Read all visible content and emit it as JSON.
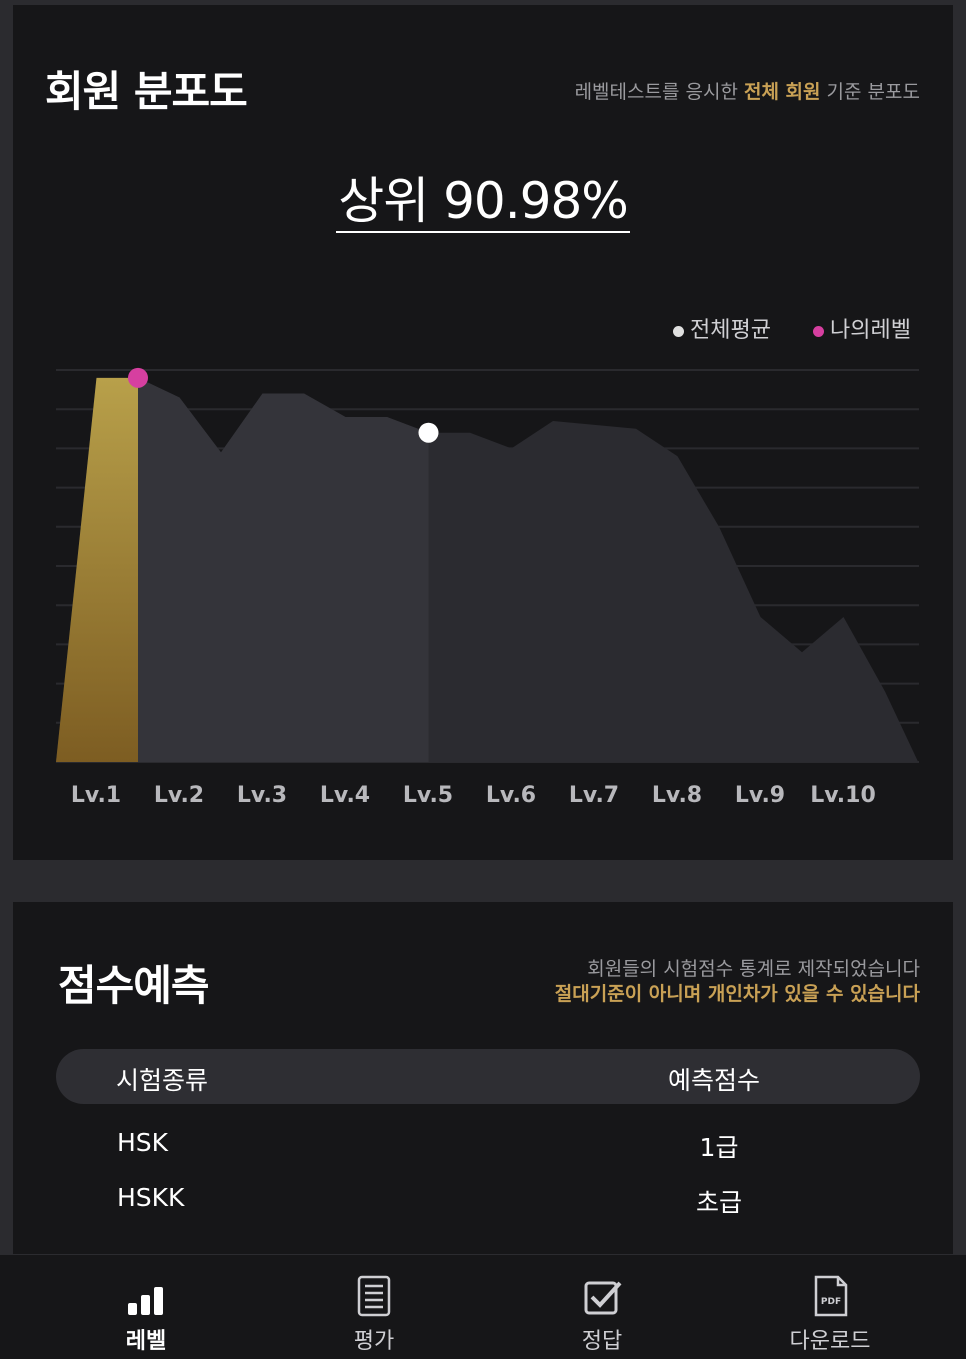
{
  "distribution": {
    "title": "회원 분포도",
    "desc_pre": "레벨테스트를 응시한 ",
    "desc_highlight": "전체 회원",
    "desc_post": " 기준 분포도",
    "rank_text": "상위 90.98%",
    "legend": [
      {
        "label": "전체평균",
        "color": "#e0e0e0"
      },
      {
        "label": "나의레벨",
        "color": "#d63fa0"
      }
    ]
  },
  "chart_data": {
    "type": "area",
    "categories": [
      "Lv.1",
      "Lv.2",
      "Lv.3",
      "Lv.4",
      "Lv.5",
      "Lv.6",
      "Lv.7",
      "Lv.8",
      "Lv.9",
      "Lv.10"
    ],
    "x": [
      0.0,
      0.5,
      1.0,
      1.5,
      2.0,
      2.5,
      3.0,
      3.5,
      4.0,
      4.5,
      5.0,
      5.5,
      6.0,
      6.5,
      7.0,
      7.5,
      8.0,
      8.5,
      9.0,
      9.5,
      10.0,
      10.4
    ],
    "values": [
      0,
      98,
      98,
      93,
      79,
      94,
      94,
      88,
      88,
      84,
      84,
      80,
      87,
      86,
      85,
      78,
      60,
      37,
      28,
      37,
      18,
      0
    ],
    "my_level_x": 1.0,
    "average_x": 4.5,
    "grid": true,
    "ylim": [
      0,
      100
    ],
    "colors": {
      "base": "#2b2b30",
      "highlight": "#34343a",
      "mine": "#b39a48",
      "mine_dot": "#d63fa0",
      "avg_dot": "#ffffff"
    }
  },
  "prediction": {
    "title": "점수예측",
    "desc_line1": "회원들의 시험점수 통계로 제작되었습니다",
    "desc_line2": "절대기준이 아니며 개인차가 있을 수 있습니다",
    "headers": {
      "type": "시험종류",
      "score": "예측점수"
    },
    "rows": [
      {
        "type": "HSK",
        "score": "1급"
      },
      {
        "type": "HSKK",
        "score": "초급"
      }
    ]
  },
  "nav": {
    "items": [
      {
        "label": "레벨",
        "icon": "bar-chart-icon",
        "active": true
      },
      {
        "label": "평가",
        "icon": "document-icon",
        "active": false
      },
      {
        "label": "정답",
        "icon": "checkbox-icon",
        "active": false
      },
      {
        "label": "다운로드",
        "icon": "pdf-file-icon",
        "active": false
      }
    ]
  }
}
